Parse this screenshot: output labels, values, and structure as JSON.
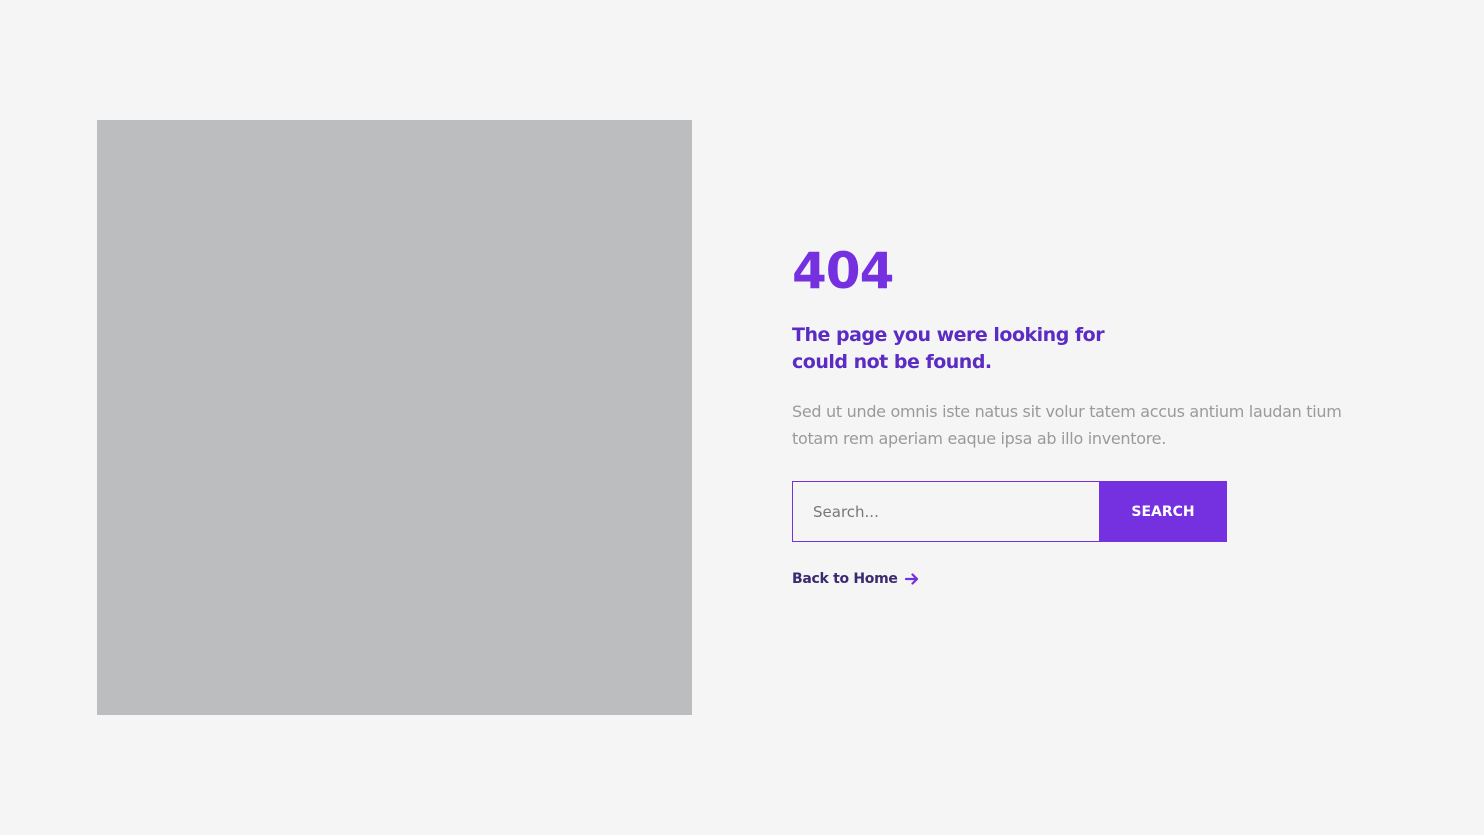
{
  "colors": {
    "accent": "#7530e0",
    "heading": "#5b2cc4",
    "muted_text": "#9a9a9a",
    "link": "#3a2a70",
    "background": "#f5f5f5",
    "image_placeholder": "#bcbdbf"
  },
  "error": {
    "code": "404",
    "title": "The page you were looking for could not be found.",
    "description": "Sed ut unde omnis iste natus sit volur tatem accus antium laudan tium totam rem aperiam eaque ipsa ab illo inventore."
  },
  "search": {
    "placeholder": "Search...",
    "value": "",
    "button_label": "SEARCH"
  },
  "back_link": {
    "label": "Back to Home",
    "icon": "arrow-right-icon"
  }
}
